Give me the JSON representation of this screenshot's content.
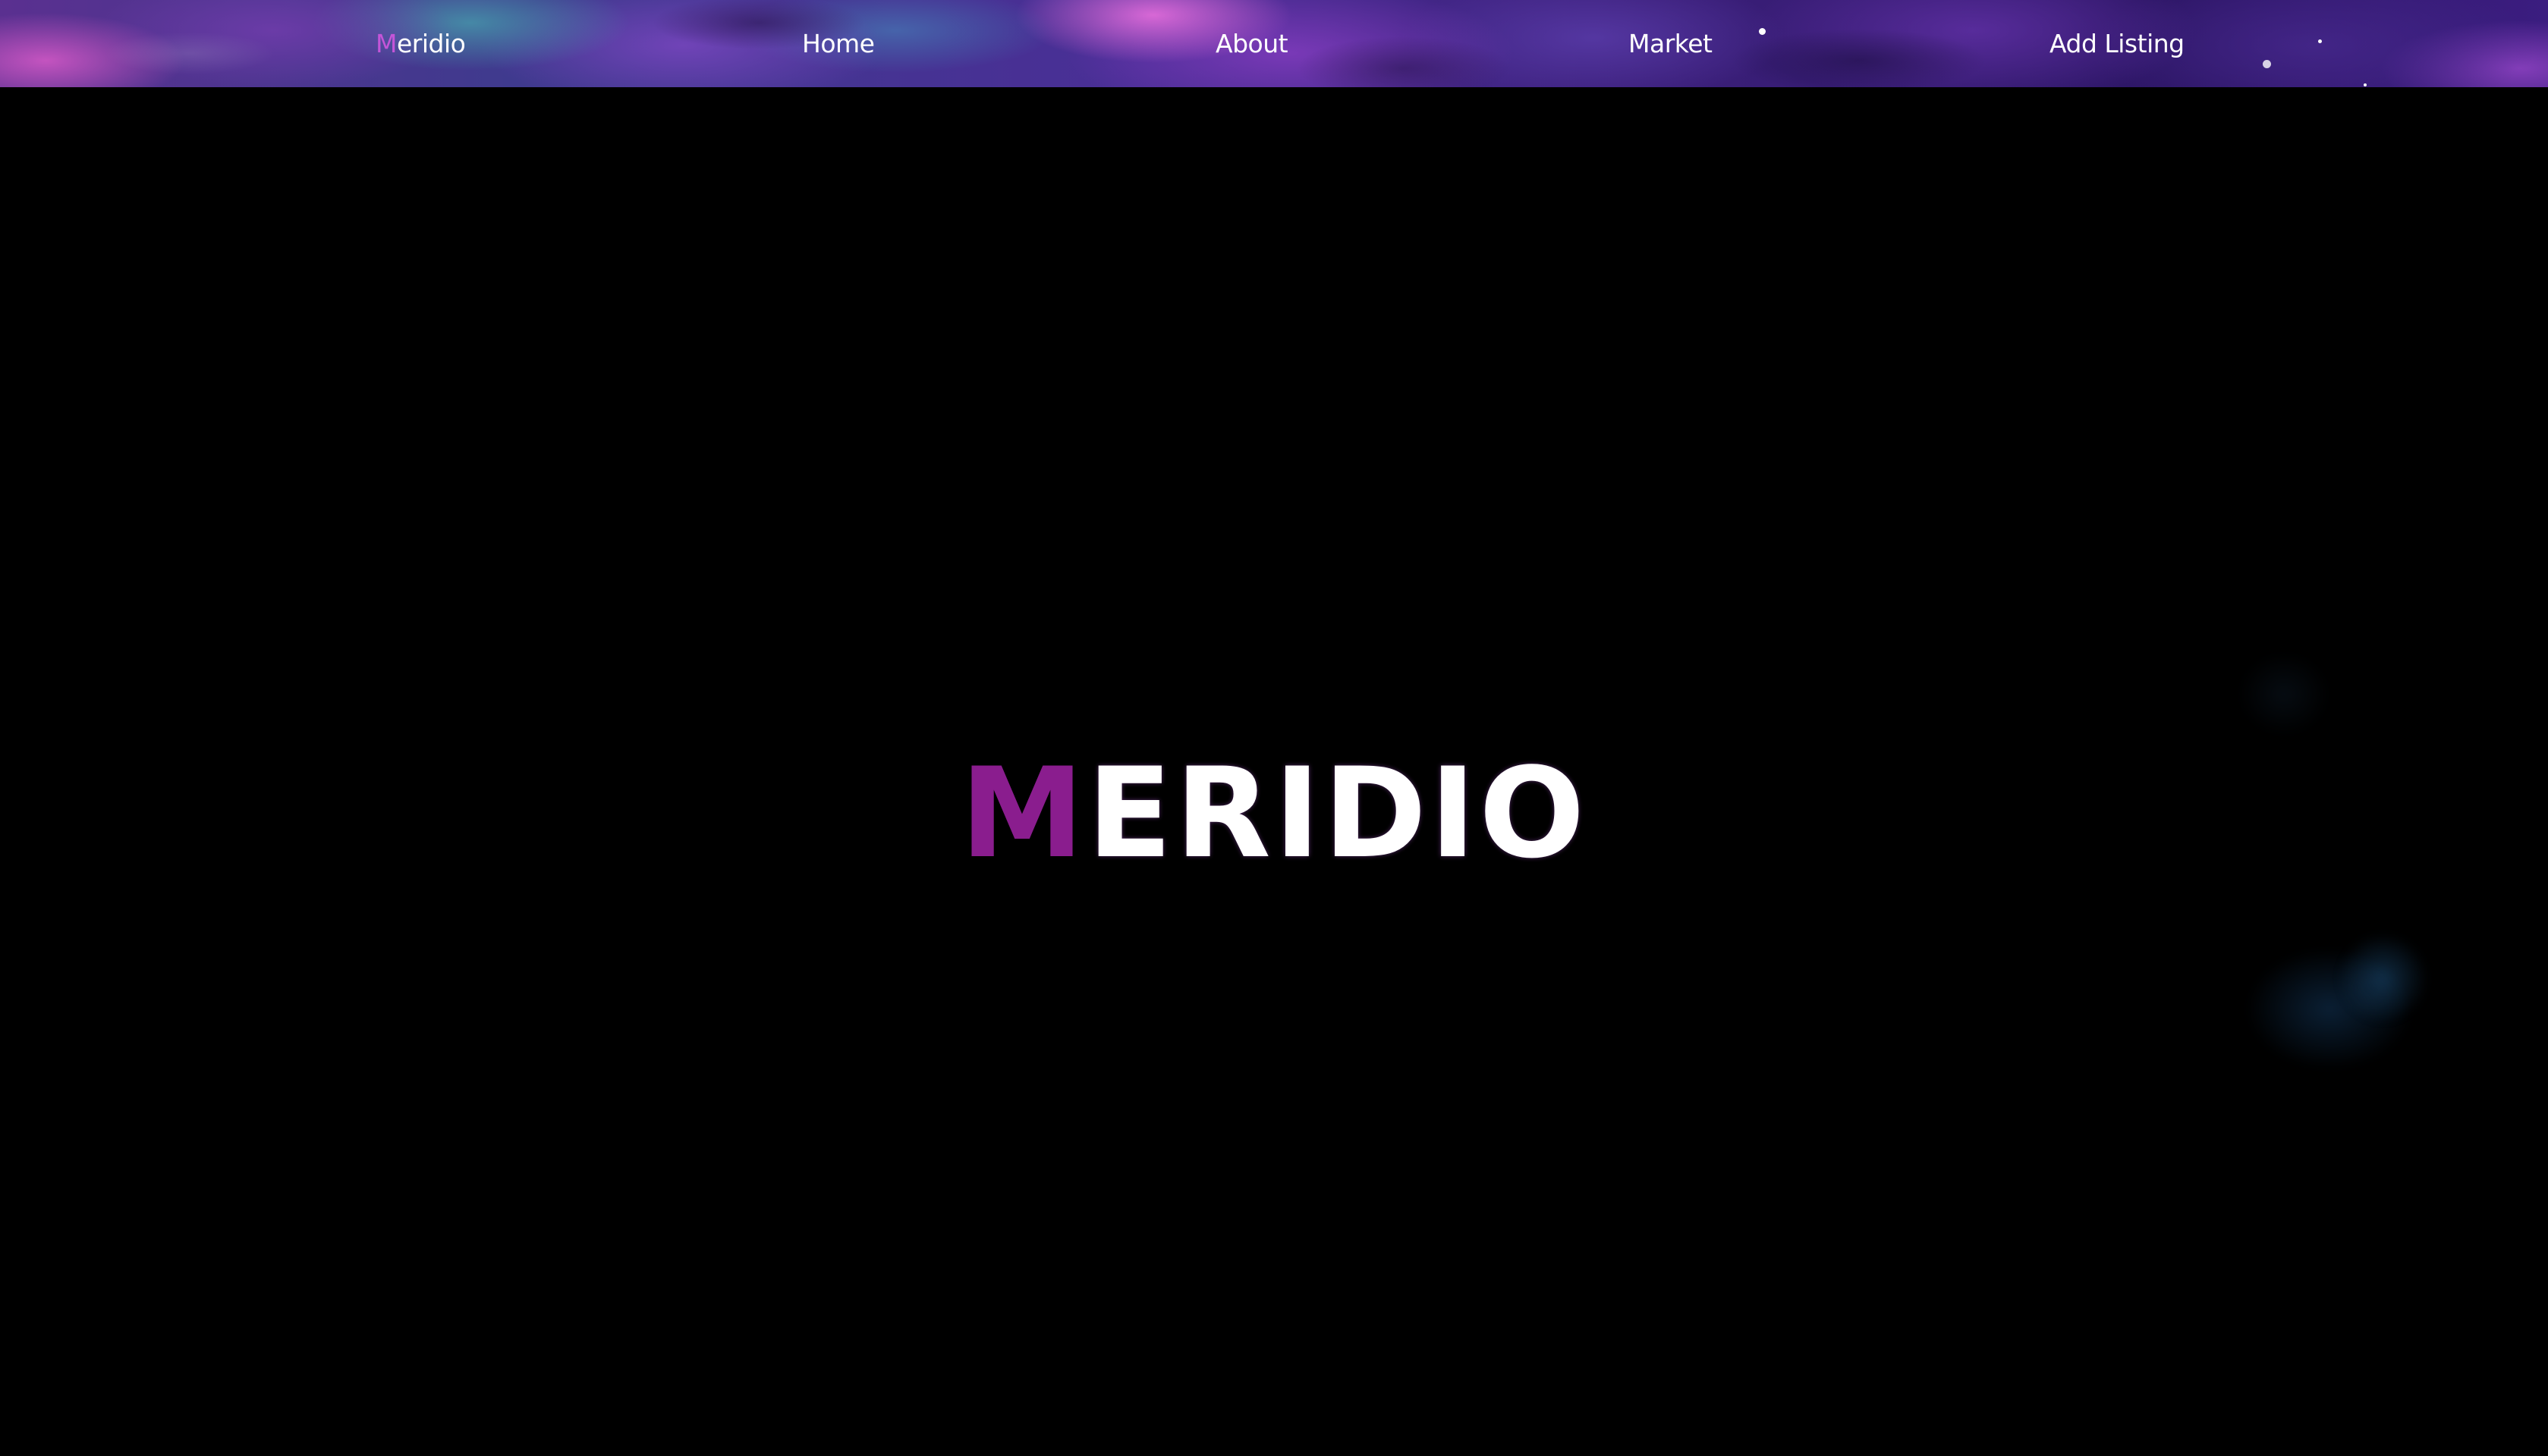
{
  "navbar": {
    "brand_first": "M",
    "brand_rest": "eridio",
    "items": [
      {
        "label": "Home"
      },
      {
        "label": "About"
      },
      {
        "label": "Market"
      },
      {
        "label": "Add Listing"
      }
    ]
  },
  "hero": {
    "title_first": "M",
    "title_rest": "ERIDIO"
  },
  "colors": {
    "accent": "#8a1d8e",
    "brand_accent": "#c455d8",
    "background": "#000000",
    "text": "#ffffff"
  }
}
